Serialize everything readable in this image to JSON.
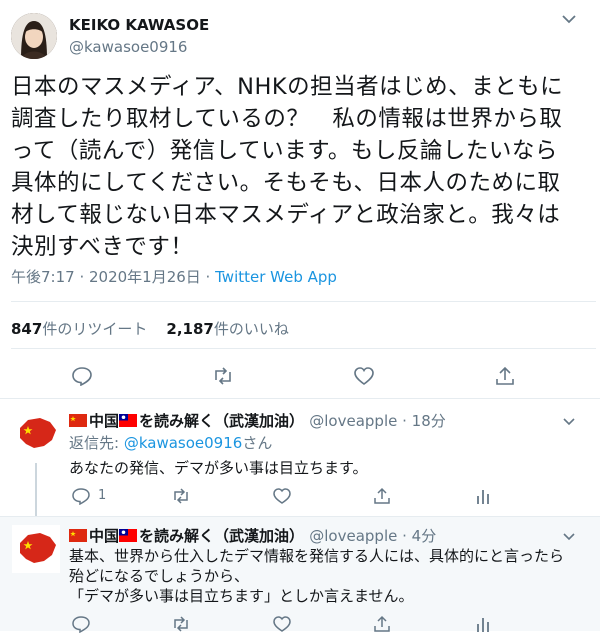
{
  "tweet": {
    "name": "KEIKO KAWASOE",
    "handle": "@kawasoe0916",
    "text": "日本のマスメディア、NHKの担当者はじめ、まともに\n調査したり取材しているの？　私の情報は世界から取\nって（読んで）発信しています。もし反論したいなら\n具体的にしてください。そもそも、日本人のために取\n材して報じない日本マスメディアと政治家と。我々は\n決別すべきです！",
    "time": "午後7:17 · 2020年1月26日 ·",
    "source": "Twitter Web App",
    "retweets_count": "847",
    "retweets_label": "件のリツイート",
    "likes_count": "2,187",
    "likes_label": "件のいいね"
  },
  "replies": [
    {
      "name": "中国",
      "name_suffix": "を読み解く（武漢加油）",
      "handle_time": "@loveapple · 18分",
      "reply_to_label": "返信先:",
      "reply_to_handle": "@kawasoe0916",
      "reply_to_suffix": "さん",
      "text": "あなたの発信、デマが多い事は目立ちます。",
      "reply_count": "1"
    },
    {
      "name": "中国",
      "name_suffix": "を読み解く（武漢加油）",
      "handle_time": "@loveapple · 4分",
      "text": "基本、世界から仕入したデマ情報を発信する人には、具体的にと言ったら\n殆どになるでしょうから、\n「デマが多い事は目立ちます」としか言えません。"
    }
  ],
  "colors": {
    "accent": "#1b95e0",
    "muted": "#657786",
    "text": "#14171a",
    "highlight_bg": "#f5f8fa"
  },
  "icons": [
    "chevron-down-icon",
    "reply-icon",
    "retweet-icon",
    "like-icon",
    "share-icon",
    "analytics-icon",
    "china-flag-icon",
    "taiwan-flag-icon"
  ]
}
